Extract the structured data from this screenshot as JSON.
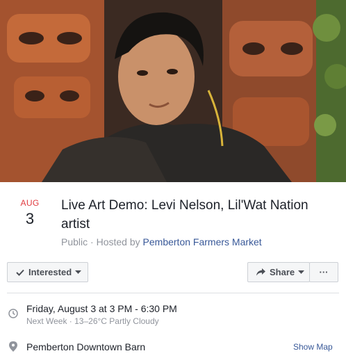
{
  "cover": {
    "photo_icon": "cover-photo"
  },
  "event": {
    "month": "AUG",
    "day": "3",
    "title": "Live Art Demo: Levi Nelson, Lil'Wat Nation artist",
    "visibility": "Public",
    "separator": " · ",
    "hosted_by_prefix": "Hosted by ",
    "host": "Pemberton Farmers Market"
  },
  "actions": {
    "interested_label": "Interested",
    "share_label": "Share",
    "more_label": "···"
  },
  "details": {
    "when": "Friday, August 3 at 3 PM - 6:30 PM",
    "when_sub": "Next Week · 13–26°C Partly Cloudy",
    "where": "Pemberton Downtown Barn",
    "show_map": "Show Map"
  },
  "colors": {
    "month": "#e0393e",
    "link": "#385898",
    "muted": "#90949c"
  },
  "icons": [
    "check-icon",
    "caret-down-icon",
    "share-arrow-icon",
    "clock-icon",
    "map-pin-icon"
  ]
}
